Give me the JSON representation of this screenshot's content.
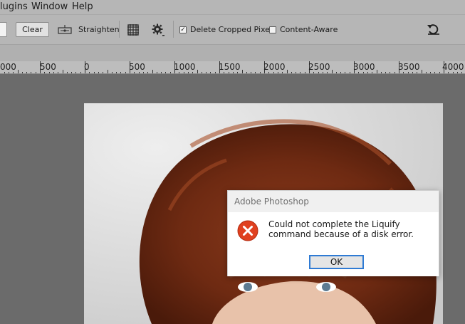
{
  "menu": {
    "plugins": "lugins",
    "window": "Window",
    "help": "Help"
  },
  "options": {
    "clear_label": "Clear",
    "straighten_label": "Straighten",
    "delete_cropped_label": "Delete Cropped Pixels",
    "delete_cropped_checked": true,
    "content_aware_label": "Content-Aware",
    "content_aware_checked": false,
    "check_glyph": "✓"
  },
  "ruler": {
    "labels": [
      "000",
      "500",
      "0",
      "500",
      "1000",
      "1500",
      "2000",
      "2500",
      "3000",
      "3500",
      "4000"
    ]
  },
  "dialog": {
    "title": "Adobe Photoshop",
    "message": "Could not complete the Liquify command because of a disk error.",
    "ok_label": "OK",
    "icon": "error-icon",
    "accent": "#2f7bd4",
    "error_color": "#e0401f"
  },
  "icons": {
    "straighten": "level-icon",
    "grid": "grid-overlay-icon",
    "settings": "gear-icon",
    "reset": "undo-icon"
  }
}
